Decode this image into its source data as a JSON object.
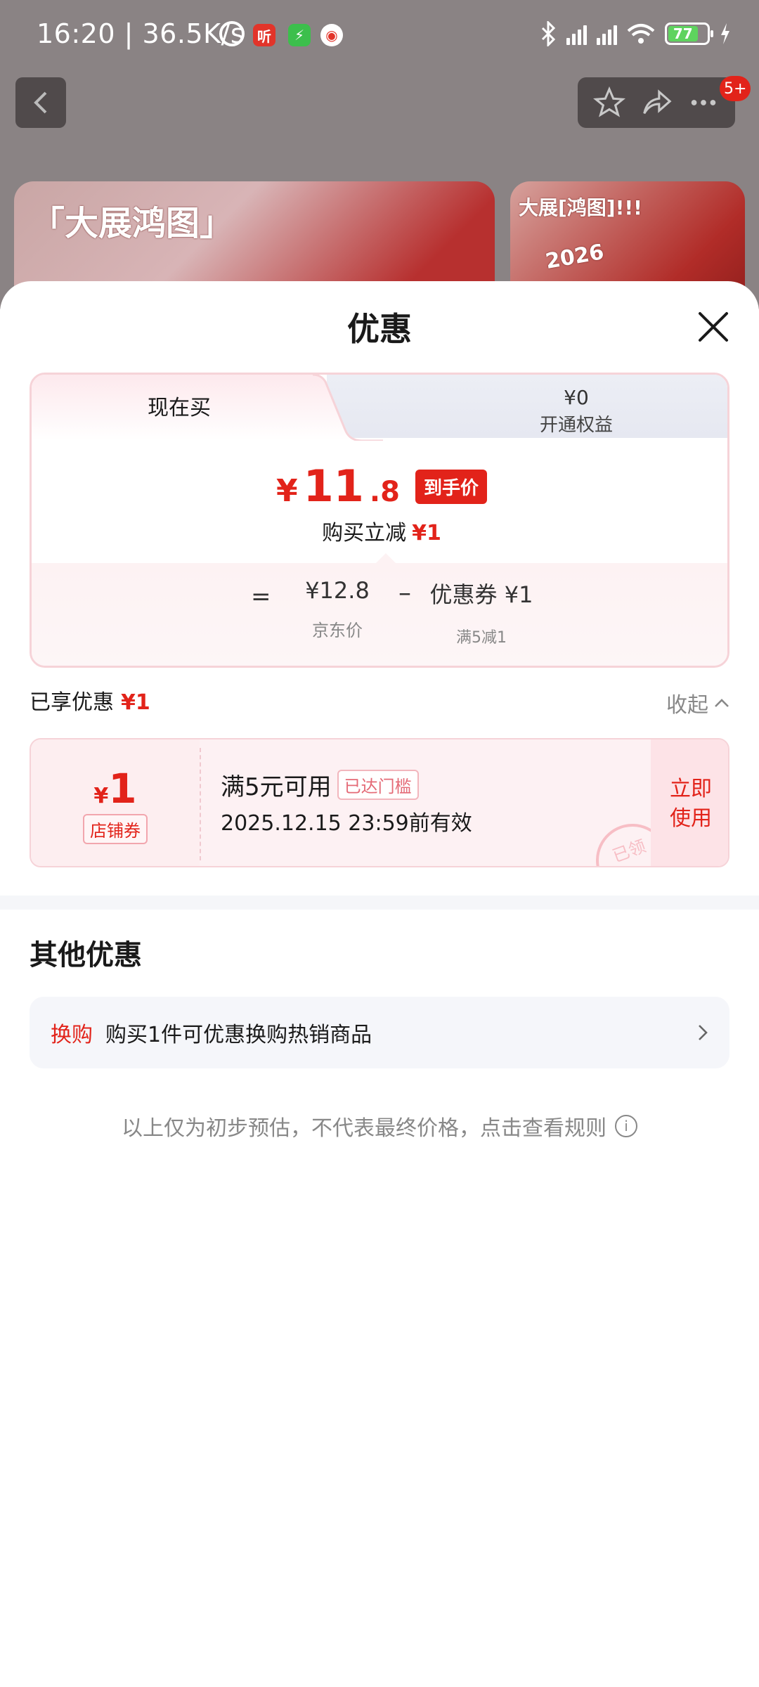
{
  "status_bar": {
    "time": "16:20",
    "speed": "36.5K/s",
    "battery": "77",
    "badge_app1": "听"
  },
  "nav": {
    "badge": "5+"
  },
  "banners": {
    "banner1_text": "「大展鸿图」",
    "banner2_text": "大展[鸿图]!!!",
    "banner2_year": "2026"
  },
  "sheet": {
    "title": "优惠",
    "tabs": {
      "now_buy": "现在买",
      "open_price": "¥0",
      "open_label": "开通权益"
    },
    "price": {
      "yen": "¥",
      "integer": "11",
      "decimal": ".8",
      "tag": "到手价"
    },
    "reduce": {
      "label": "购买立减",
      "amount": "¥1"
    },
    "calc": {
      "equals": "=",
      "jd_price": "¥12.8",
      "jd_label": "京东价",
      "minus": "–",
      "coupon_value": "优惠券 ¥1",
      "coupon_rule": "满5减1"
    },
    "enjoyed": {
      "label": "已享优惠",
      "amount": "¥1",
      "collapse": "收起"
    },
    "coupon": {
      "yen": "¥",
      "amount": "1",
      "type": "店铺券",
      "condition": "满5元可用",
      "reached": "已达门槛",
      "valid": "2025.12.15 23:59前有效",
      "use_line1": "立即",
      "use_line2": "使用",
      "stamp": "已领"
    },
    "other": {
      "title": "其他优惠",
      "swap_tag": "换购",
      "swap_text": "购买1件可优惠换购热销商品"
    },
    "disclaimer": "以上仅为初步预估，不代表最终价格，点击查看规则"
  },
  "colors": {
    "accent_red": "#e2231a",
    "card_border": "#f6d3d8"
  }
}
